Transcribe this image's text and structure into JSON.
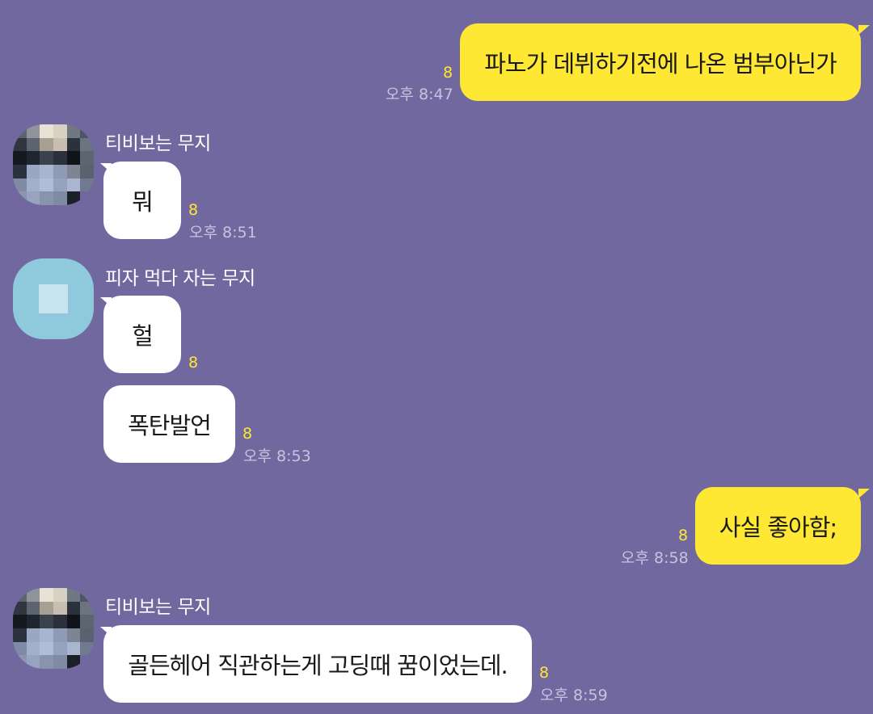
{
  "chat": {
    "messages": [
      {
        "id": "m1",
        "direction": "out",
        "text": "파노가 데뷔하기전에 나온 범부아닌가",
        "unread": "8",
        "time": "오후 8:47"
      },
      {
        "id": "m2",
        "direction": "in",
        "sender": "티비보는 무지",
        "text": "뭐",
        "unread": "8",
        "time": "오후 8:51"
      },
      {
        "id": "m3",
        "direction": "in",
        "sender": "피자 먹다 자는 무지",
        "text": "헐",
        "unread": "8"
      },
      {
        "id": "m4",
        "direction": "in",
        "text": "폭탄발언",
        "unread": "8",
        "time": "오후 8:53"
      },
      {
        "id": "m5",
        "direction": "out",
        "text": "사실 좋아함;",
        "unread": "8",
        "time": "오후 8:58"
      },
      {
        "id": "m6",
        "direction": "in",
        "sender": "티비보는 무지",
        "text": "골든헤어 직관하는게 고딩때 꿈이었는데.",
        "unread": "8",
        "time": "오후 8:59"
      }
    ]
  },
  "colors": {
    "background": "#71689f",
    "outgoing_bubble": "#fee833",
    "incoming_bubble": "#ffffff",
    "unread_count": "#fee833",
    "timestamp": "#c9c3de"
  },
  "avatars": {
    "muji_tv": "pixelated-mosaic-avatar",
    "muji_pizza": "light-blue-placeholder-avatar"
  }
}
